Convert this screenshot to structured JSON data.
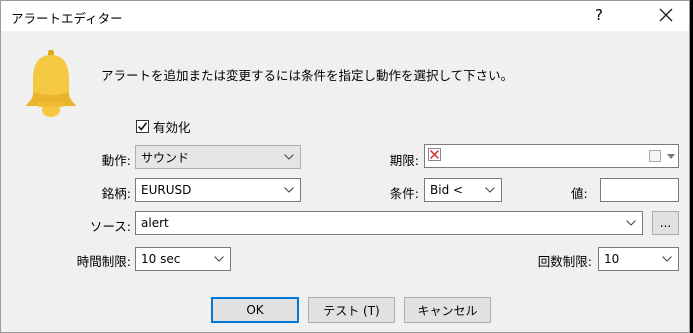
{
  "window": {
    "title": "アラートエディター",
    "help_symbol": "?"
  },
  "message": "アラートを追加または変更するには条件を指定し動作を選択して下さい。",
  "enabled": {
    "label": "有効化",
    "checked": true
  },
  "action": {
    "label": "動作:",
    "value": "サウンド"
  },
  "expiry": {
    "label": "期限:"
  },
  "symbol": {
    "label": "銘柄:",
    "value": "EURUSD"
  },
  "condition": {
    "label": "条件:",
    "value": "Bid <"
  },
  "value_field": {
    "label": "値:",
    "value": ""
  },
  "source": {
    "label": "ソース:",
    "value": "alert",
    "browse_label": "..."
  },
  "timeout": {
    "label": "時間制限:",
    "value": "10 sec"
  },
  "max_iterations": {
    "label": "回数制限:",
    "value": "10"
  },
  "buttons": {
    "ok": "OK",
    "test": "テスト (T)",
    "cancel": "キャンセル"
  },
  "colors": {
    "bell": "#f5c842",
    "accent": "#0078d7",
    "date_x": "#d33030"
  }
}
